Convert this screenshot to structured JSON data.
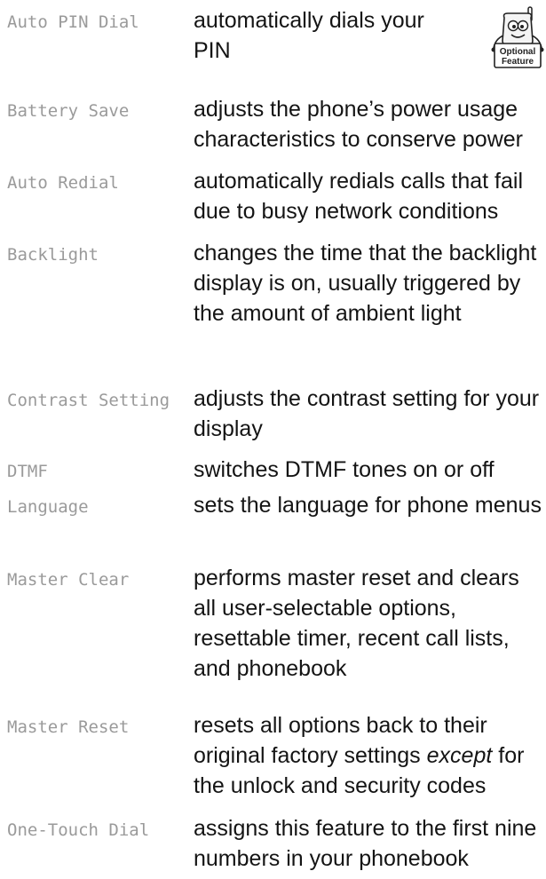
{
  "features": [
    {
      "term": "Auto PIN Dial",
      "description": "automatically dials your PIN"
    },
    {
      "term": "Battery Save",
      "description": "adjusts the phone’s power usage characteristics to conserve power"
    },
    {
      "term": "Auto Redial",
      "description": "automatically redials calls that fail due to busy network conditions"
    },
    {
      "term": "Backlight",
      "description": "changes the time that the backlight display is on, usually triggered by the amount of ambient light"
    },
    {
      "term": "Contrast Setting",
      "description": "adjusts the contrast setting for your display"
    },
    {
      "term": "DTMF",
      "description": "switches DTMF tones on or off"
    },
    {
      "term": "Language",
      "description": "sets the language for phone menus"
    },
    {
      "term": "Master Clear",
      "description": "performs master reset and clears all user-selectable options, resettable timer, recent call lists, and phonebook"
    },
    {
      "term": "Master Reset",
      "description_before": "resets all options back to their original factory settings",
      "description_emphasis": "except",
      "description_after": "for the unlock and security codes"
    },
    {
      "term": "One-Touch Dial",
      "description": "assigns this feature to the first nine numbers in your phonebook"
    }
  ],
  "optional_feature_badge": {
    "icon": "optional-feature-phone-icon",
    "label_line1": "Optional",
    "label_line2": "Feature"
  }
}
